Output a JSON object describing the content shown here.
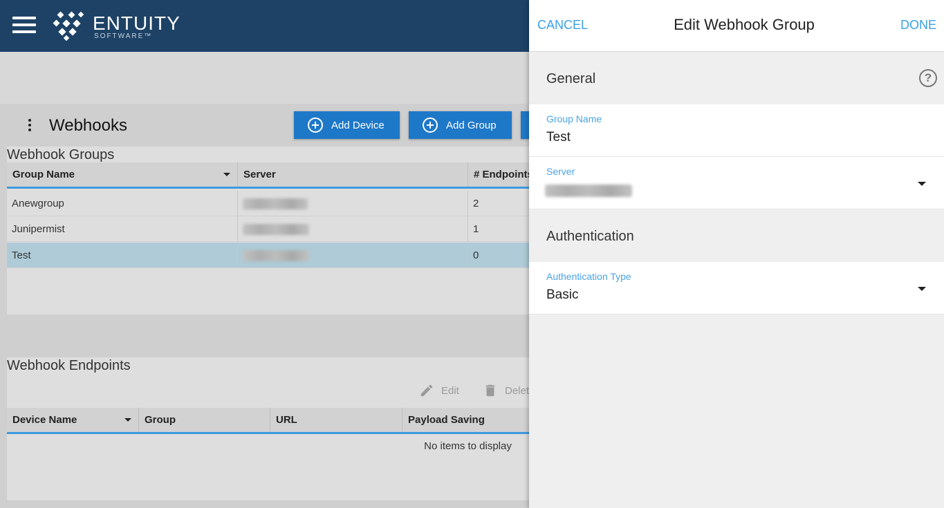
{
  "brand": {
    "name": "ENTUITY",
    "sub": "SOFTWARE™"
  },
  "page": {
    "title": "Webhooks",
    "add_device": "Add Device",
    "add_group": "Add Group"
  },
  "groups": {
    "title": "Webhook Groups",
    "columns": [
      "Group Name",
      "Server",
      "# Endpoints"
    ],
    "rows": [
      {
        "name": "Anewgroup",
        "endpoints": "2"
      },
      {
        "name": "Junipermist",
        "endpoints": "1"
      },
      {
        "name": "Test",
        "endpoints": "0"
      }
    ]
  },
  "endpoints": {
    "title": "Webhook Endpoints",
    "edit": "Edit",
    "delete": "Delet",
    "columns": [
      "Device Name",
      "Group",
      "URL",
      "Payload Saving"
    ],
    "empty": "No items to display"
  },
  "drawer": {
    "cancel": "CANCEL",
    "title": "Edit Webhook Group",
    "done": "DONE",
    "general": "General",
    "help": "?",
    "group_name_label": "Group Name",
    "group_name_value": "Test",
    "server_label": "Server",
    "auth_section": "Authentication",
    "auth_type_label": "Authentication Type",
    "auth_type_value": "Basic"
  },
  "icons": [
    "menu-icon",
    "kebab-icon",
    "add-circle-icon",
    "edit-icon",
    "delete-icon",
    "help-icon",
    "dropdown-caret-icon"
  ],
  "colors": {
    "topbar": "#1d4266",
    "accent": "#1e78c8",
    "link": "#3aa0e8",
    "selected_row": "#aecbd7"
  }
}
